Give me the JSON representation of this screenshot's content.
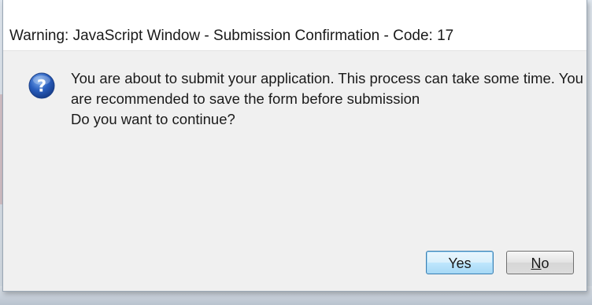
{
  "dialog": {
    "title": "Warning: JavaScript Window - Submission Confirmation - Code: 17",
    "icon": "question-icon",
    "message_lines": [
      "You are about to submit your application. This process can take some time. You",
      "are recommended to save the form before submission",
      "Do you want to continue?"
    ],
    "buttons": {
      "yes_label": "Yes",
      "no_mnemonic": "N",
      "no_rest": "o"
    }
  },
  "colors": {
    "icon_blue": "#2a5fbf",
    "default_button_border": "#3c7fb1"
  }
}
